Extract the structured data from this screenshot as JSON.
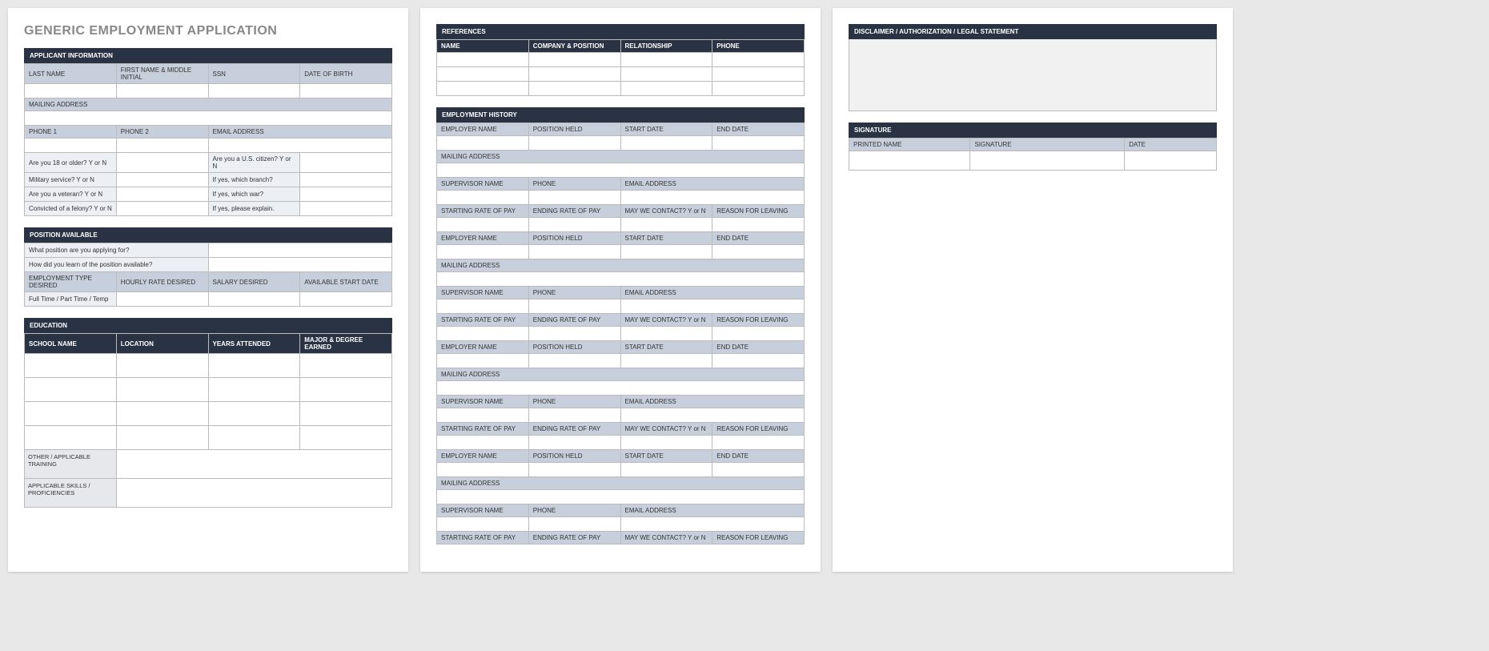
{
  "title": "GENERIC EMPLOYMENT APPLICATION",
  "sections": {
    "applicant": {
      "header": "APPLICANT INFORMATION",
      "last_name": "LAST NAME",
      "first_name": "FIRST NAME & MIDDLE INITIAL",
      "ssn": "SSN",
      "dob": "DATE OF BIRTH",
      "mailing": "MAILING ADDRESS",
      "phone1": "PHONE 1",
      "phone2": "PHONE 2",
      "email": "EMAIL ADDRESS",
      "q18": "Are you 18 or older?  Y or N",
      "qcitizen": "Are you a U.S. citizen?  Y or N",
      "qmilitary": "Military service?  Y or N",
      "qmilitary_b": "If yes, which branch?",
      "qveteran": "Are you a veteran?  Y or N",
      "qveteran_w": "If yes, which war?",
      "qfelony": "Convicted of a felony?  Y or N",
      "qfelony_e": "If yes, please explain."
    },
    "position": {
      "header": "POSITION AVAILABLE",
      "q1": "What position are you applying for?",
      "q2": "How did you learn of the position available?",
      "emp_type": "EMPLOYMENT TYPE DESIRED",
      "hourly": "HOURLY RATE DESIRED",
      "salary": "SALARY DESIRED",
      "start": "AVAILABLE START DATE",
      "emp_type_val": "Full Time / Part Time / Temp"
    },
    "education": {
      "header": "EDUCATION",
      "school": "SCHOOL NAME",
      "location": "LOCATION",
      "years": "YEARS ATTENDED",
      "major": "MAJOR & DEGREE EARNED",
      "other": "OTHER / APPLICABLE TRAINING",
      "skills": "APPLICABLE SKILLS / PROFICIENCIES"
    },
    "references": {
      "header": "REFERENCES",
      "name": "NAME",
      "company": "COMPANY & POSITION",
      "relationship": "RELATIONSHIP",
      "phone": "PHONE"
    },
    "employment": {
      "header": "EMPLOYMENT HISTORY",
      "employer": "EMPLOYER NAME",
      "pos_held": "POSITION HELD",
      "start_date": "START DATE",
      "end_date": "END DATE",
      "mailing": "MAILING ADDRESS",
      "supervisor": "SUPERVISOR NAME",
      "phone": "PHONE",
      "email": "EMAIL ADDRESS",
      "start_pay": "STARTING RATE OF PAY",
      "end_pay": "ENDING RATE OF PAY",
      "contact": "MAY WE CONTACT? Y or N",
      "reason": "REASON FOR LEAVING"
    },
    "disclaimer": {
      "header": "DISCLAIMER / AUTHORIZATION / LEGAL STATEMENT"
    },
    "signature": {
      "header": "SIGNATURE",
      "printed": "PRINTED NAME",
      "sig": "SIGNATURE",
      "date": "DATE"
    }
  }
}
